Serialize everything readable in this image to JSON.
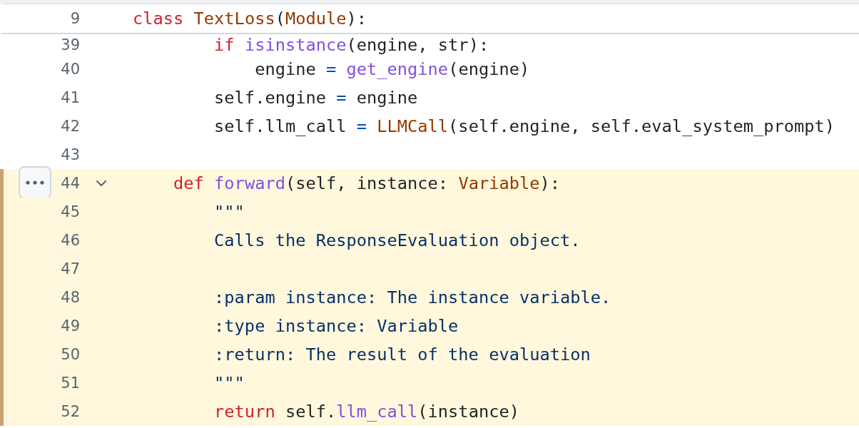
{
  "sticky_header": {
    "number": "9",
    "tokens": [
      {
        "kind": "keyword",
        "text": "class "
      },
      {
        "kind": "class",
        "text": "TextLoss"
      },
      {
        "kind": "plain",
        "text": "("
      },
      {
        "kind": "class",
        "text": "Module"
      },
      {
        "kind": "plain",
        "text": "):"
      }
    ]
  },
  "lines": [
    {
      "number": "39",
      "highlighted": false,
      "tokens": [
        {
          "kind": "keyword",
          "text": "        if "
        },
        {
          "kind": "function",
          "text": "isinstance"
        },
        {
          "kind": "plain",
          "text": "(engine, str):"
        }
      ]
    },
    {
      "number": "40",
      "highlighted": false,
      "tokens": [
        {
          "kind": "plain",
          "text": "            engine "
        },
        {
          "kind": "operator",
          "text": "= "
        },
        {
          "kind": "function",
          "text": "get_engine"
        },
        {
          "kind": "plain",
          "text": "(engine)"
        }
      ]
    },
    {
      "number": "41",
      "highlighted": false,
      "tokens": [
        {
          "kind": "plain",
          "text": "        self.engine "
        },
        {
          "kind": "operator",
          "text": "="
        },
        {
          "kind": "plain",
          "text": " engine"
        }
      ]
    },
    {
      "number": "42",
      "highlighted": false,
      "tokens": [
        {
          "kind": "plain",
          "text": "        self.llm_call "
        },
        {
          "kind": "operator",
          "text": "= "
        },
        {
          "kind": "class",
          "text": "LLMCall"
        },
        {
          "kind": "plain",
          "text": "(self.engine, self.eval_system_prompt)"
        }
      ]
    },
    {
      "number": "43",
      "highlighted": false
    },
    {
      "number": "44",
      "highlighted": true,
      "expanded": true,
      "actions": true,
      "tokens": [
        {
          "kind": "keyword",
          "text": "    def "
        },
        {
          "kind": "function",
          "text": "forward"
        },
        {
          "kind": "plain",
          "text": "(self, instance: "
        },
        {
          "kind": "class",
          "text": "Variable"
        },
        {
          "kind": "plain",
          "text": "):"
        }
      ]
    },
    {
      "number": "45",
      "highlighted": true,
      "tokens": [
        {
          "kind": "string",
          "text": "        \"\"\""
        }
      ]
    },
    {
      "number": "46",
      "highlighted": true,
      "tokens": [
        {
          "kind": "string",
          "text": "        Calls the ResponseEvaluation object."
        }
      ]
    },
    {
      "number": "47",
      "highlighted": true
    },
    {
      "number": "48",
      "highlighted": true,
      "tokens": [
        {
          "kind": "string",
          "text": "        :param instance: The instance variable."
        }
      ]
    },
    {
      "number": "49",
      "highlighted": true,
      "tokens": [
        {
          "kind": "string",
          "text": "        :type instance: Variable"
        }
      ]
    },
    {
      "number": "50",
      "highlighted": true,
      "tokens": [
        {
          "kind": "string",
          "text": "        :return: The result of the evaluation"
        }
      ]
    },
    {
      "number": "51",
      "highlighted": true,
      "tokens": [
        {
          "kind": "string",
          "text": "        \"\"\""
        }
      ]
    },
    {
      "number": "52",
      "highlighted": true,
      "tokens": [
        {
          "kind": "keyword",
          "text": "        return "
        },
        {
          "kind": "plain",
          "text": "self."
        },
        {
          "kind": "function",
          "text": "llm_call"
        },
        {
          "kind": "plain",
          "text": "(instance)"
        }
      ]
    }
  ]
}
